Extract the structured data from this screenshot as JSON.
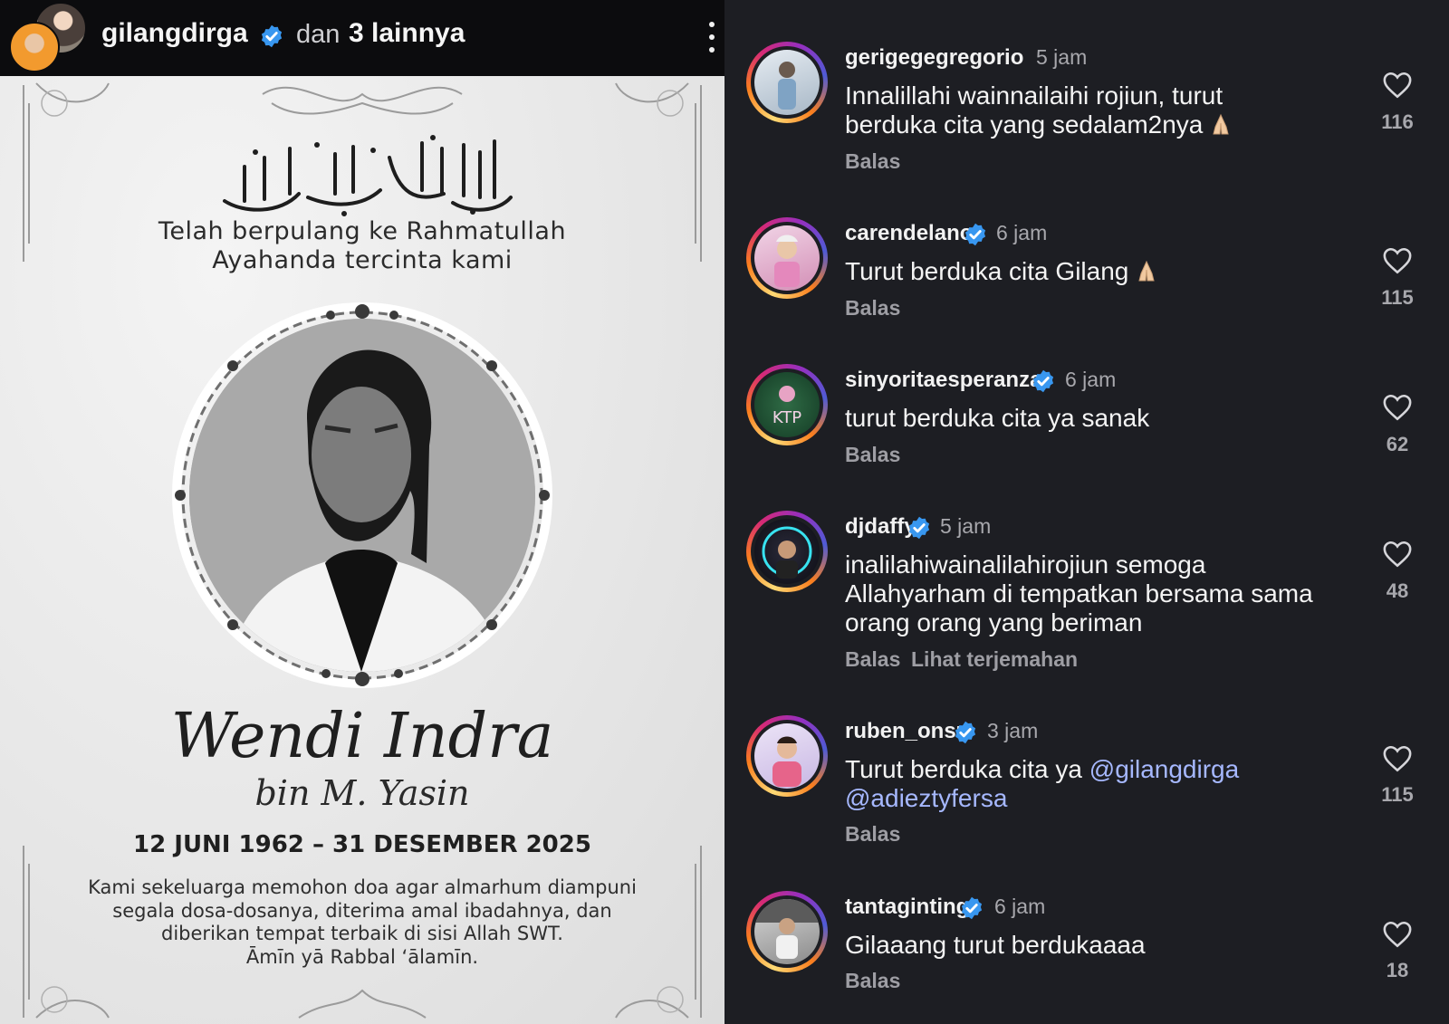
{
  "post": {
    "header": {
      "username": "gilangdirga",
      "others_prefix": "dan",
      "others_count": "3 lainnya"
    },
    "card": {
      "opener_line1": "Telah berpulang ke Rahmatullah",
      "opener_line2": "Ayahanda tercinta kami",
      "name": "Wendi Indra",
      "bin": "bin M. Yasin",
      "dates": "12 JUNI 1962 – 31 DESEMBER 2025",
      "prayer_line1": "Kami sekeluarga memohon doa agar almarhum diampuni",
      "prayer_line2": "segala dosa-dosanya, diterima amal ibadahnya, dan",
      "prayer_line3": "diberikan tempat terbaik di sisi Allah SWT.",
      "prayer_line4": "Āmīn yā Rabbal ‘ālamīn."
    }
  },
  "comments": [
    {
      "username": "gerigegegregorio",
      "time": "5 jam",
      "verified": false,
      "text_line1": "Innalillahi wainnailaihi rojiun, turut",
      "text_line2": "berduka cita yang sedalam2nya",
      "reply": "Balas",
      "likes": "116"
    },
    {
      "username": "carendelano",
      "time": "6 jam",
      "verified": true,
      "text_line1": "Turut berduka cita Gilang",
      "reply": "Balas",
      "likes": "115"
    },
    {
      "username": "sinyoritaesperanza",
      "time": "6 jam",
      "verified": true,
      "text_line1": "turut berduka cita ya sanak",
      "reply": "Balas",
      "likes": "62"
    },
    {
      "username": "djdaffy",
      "time": "5 jam",
      "verified": true,
      "text_line1": "inalilahiwainalilahirojiun semoga",
      "text_line2": "Allahyarham di tempatkan bersama sama",
      "text_line3": "orang orang yang beriman",
      "reply": "Balas",
      "translate": "Lihat terjemahan",
      "likes": "48"
    },
    {
      "username": "ruben_onsu",
      "time": "3 jam",
      "verified": true,
      "text_prefix": "Turut berduka cita ya",
      "mention1": "@gilangdirga",
      "mention2": "@adieztyfersa",
      "reply": "Balas",
      "likes": "115"
    },
    {
      "username": "tantaginting",
      "time": "6 jam",
      "verified": true,
      "text_line1": "Gilaaang turut berdukaaaa",
      "reply": "Balas",
      "likes": "18"
    }
  ],
  "colors": {
    "background_dark": "#1d1e23",
    "mention": "#a6b8ff",
    "verified_badge": "#3897f0"
  }
}
